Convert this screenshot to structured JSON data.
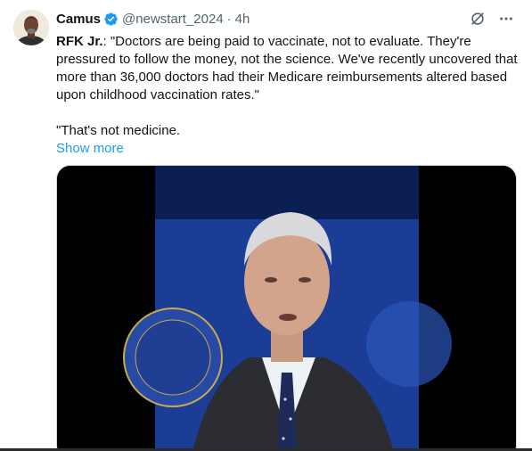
{
  "author": {
    "display_name": "Camus",
    "handle": "@newstart_2024",
    "separator": "·",
    "time": "4h",
    "verified": true,
    "verified_color": "#1d9bf0"
  },
  "post": {
    "speaker": "RFK Jr.",
    "body": ": \"Doctors are being paid to vaccinate, not to evaluate. They're pressured to follow the money, not the science. We've recently uncovered that more than 36,000 doctors had their Medicare reimbursements altered based upon childhood vaccination rates.\"\n\n\"That's not medicine.",
    "show_more_label": "Show more"
  },
  "actions": {
    "grok_icon": "slashed-circle-icon",
    "more_icon": "more-dots-icon"
  },
  "media": {
    "type": "video",
    "background_color": "#000000",
    "stage_color": "#1a3a8f"
  },
  "colors": {
    "link": "#1d9bf0",
    "secondary_text": "#536471",
    "primary_text": "#0f1419"
  }
}
